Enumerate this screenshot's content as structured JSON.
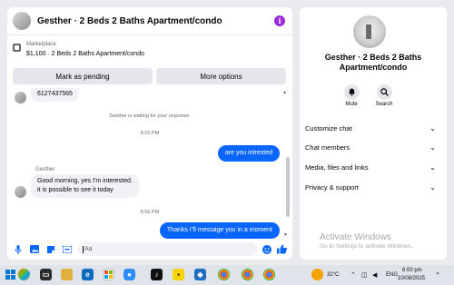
{
  "chat": {
    "title": "Gesther · 2 Beds 2 Baths Apartment/condo",
    "marketplace_label": "Marketplace",
    "listing": "$1,100 · 2 Beds 2 Baths Apartment/condo",
    "mark_pending": "Mark as pending",
    "more_options": "More options",
    "phone_partial": "6127437565",
    "waiting_note": "Gesther is waiting for your response.",
    "time1": "5:02 PM",
    "msg_out1": "are you intrested",
    "sender_name": "Gesther",
    "msg_in_line1": "Good morning, yes I'm interested.",
    "msg_in_line2": "it is possible to see it today",
    "time2": "5:56 PM",
    "msg_out2": "Thanks i\"ll message you in a moment",
    "composer_placeholder": "Aa"
  },
  "info": {
    "title_line1": "Gesther · 2 Beds 2 Baths",
    "title_line2": "Apartment/condo",
    "mute": "Mute",
    "search": "Search",
    "rows": [
      "Customize chat",
      "Chat members",
      "Media, files and links",
      "Privacy & support"
    ],
    "watermark_title": "Activate Windows",
    "watermark_sub": "Go to Settings to activate Windows."
  },
  "taskbar": {
    "temperature": "32°C",
    "lang": "ENG",
    "time": "6:00 pm",
    "date": "10/08/2025"
  },
  "colors": {
    "accent": "#0866ff",
    "info_icon": "#9b2bd6"
  }
}
